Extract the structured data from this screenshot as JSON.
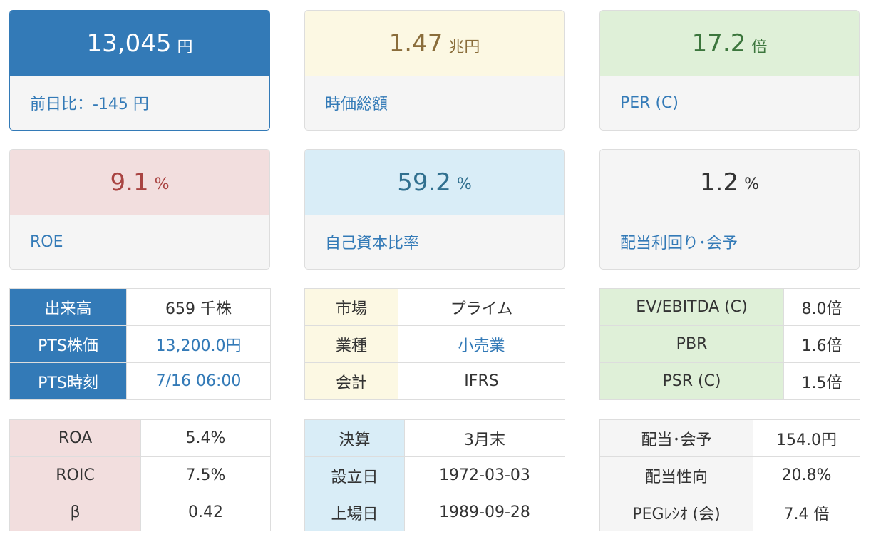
{
  "cards": [
    {
      "value": "13,045",
      "unit": "円",
      "label": "前日比：-145 円"
    },
    {
      "value": "1.47",
      "unit": "兆円",
      "label": "時価総額"
    },
    {
      "value": "17.2",
      "unit": "倍",
      "label": "PER (C)"
    },
    {
      "value": "9.1",
      "unit": "%",
      "label": "ROE"
    },
    {
      "value": "59.2",
      "unit": "%",
      "label": "自己資本比率"
    },
    {
      "value": "1.2",
      "unit": "%",
      "label": "配当利回り･会予"
    }
  ],
  "tables": {
    "trading": [
      {
        "key": "出来高",
        "value": "659 千株"
      },
      {
        "key": "PTS株価",
        "value": "13,200.0円"
      },
      {
        "key": "PTS時刻",
        "value": "7/16 06:00"
      }
    ],
    "profile": [
      {
        "key": "市場",
        "value": "プライム"
      },
      {
        "key": "業種",
        "value": "小売業"
      },
      {
        "key": "会計",
        "value": "IFRS"
      }
    ],
    "valuation": [
      {
        "key": "EV/EBITDA (C)",
        "value": "8.0倍"
      },
      {
        "key": "PBR",
        "value": "1.6倍"
      },
      {
        "key": "PSR (C)",
        "value": "1.5倍"
      }
    ],
    "returns": [
      {
        "key": "ROA",
        "value": "5.4%"
      },
      {
        "key": "ROIC",
        "value": "7.5%"
      },
      {
        "key": "β",
        "value": "0.42"
      }
    ],
    "dates": [
      {
        "key": "決算",
        "value": "3月末"
      },
      {
        "key": "設立日",
        "value": "1972-03-03"
      },
      {
        "key": "上場日",
        "value": "1989-09-28"
      }
    ],
    "dividend": [
      {
        "key": "配当･会予",
        "value": "154.0円"
      },
      {
        "key": "配当性向",
        "value": "20.8%"
      },
      {
        "key": "PEGﾚｼｵ (会)",
        "value": "7.4 倍"
      }
    ]
  }
}
